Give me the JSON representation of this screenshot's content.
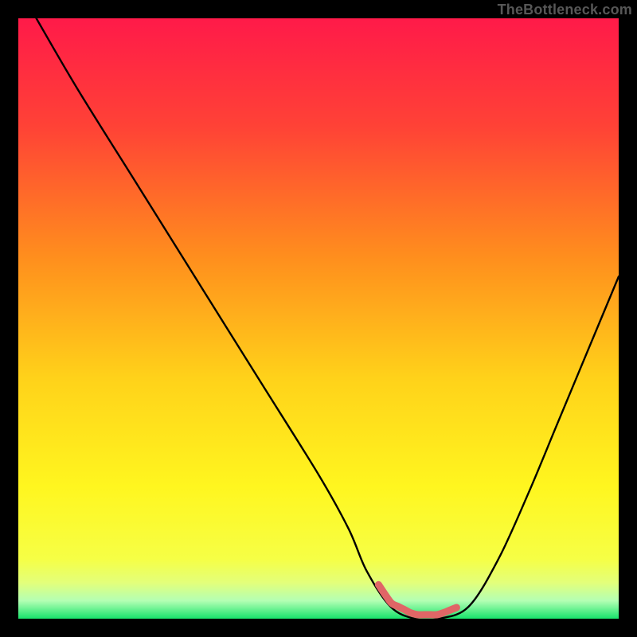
{
  "attribution": "TheBottleneck.com",
  "colors": {
    "frame": "#000000",
    "gradient_stops": [
      {
        "offset": 0.0,
        "color": "#ff1a49"
      },
      {
        "offset": 0.18,
        "color": "#ff4236"
      },
      {
        "offset": 0.4,
        "color": "#ff8f1d"
      },
      {
        "offset": 0.6,
        "color": "#ffd21a"
      },
      {
        "offset": 0.78,
        "color": "#fff61f"
      },
      {
        "offset": 0.9,
        "color": "#f6ff45"
      },
      {
        "offset": 0.94,
        "color": "#e3ff7a"
      },
      {
        "offset": 0.97,
        "color": "#b4ffb4"
      },
      {
        "offset": 1.0,
        "color": "#17e36b"
      }
    ],
    "curve": "#000000",
    "marker": "#e06666"
  },
  "chart_data": {
    "type": "line",
    "title": "",
    "xlabel": "",
    "ylabel": "",
    "xlim": [
      0,
      100
    ],
    "ylim": [
      0,
      100
    ],
    "x": [
      3,
      10,
      20,
      30,
      40,
      50,
      55,
      58,
      62,
      66,
      70,
      75,
      80,
      85,
      90,
      95,
      100
    ],
    "values": [
      100,
      88,
      72,
      56,
      40,
      24,
      15,
      8,
      2,
      0,
      0,
      2,
      10,
      21,
      33,
      45,
      57
    ],
    "annotations": {
      "bottleneck_plateau_x_range": [
        60,
        73
      ],
      "plateau_marker_color": "#e06666"
    }
  }
}
